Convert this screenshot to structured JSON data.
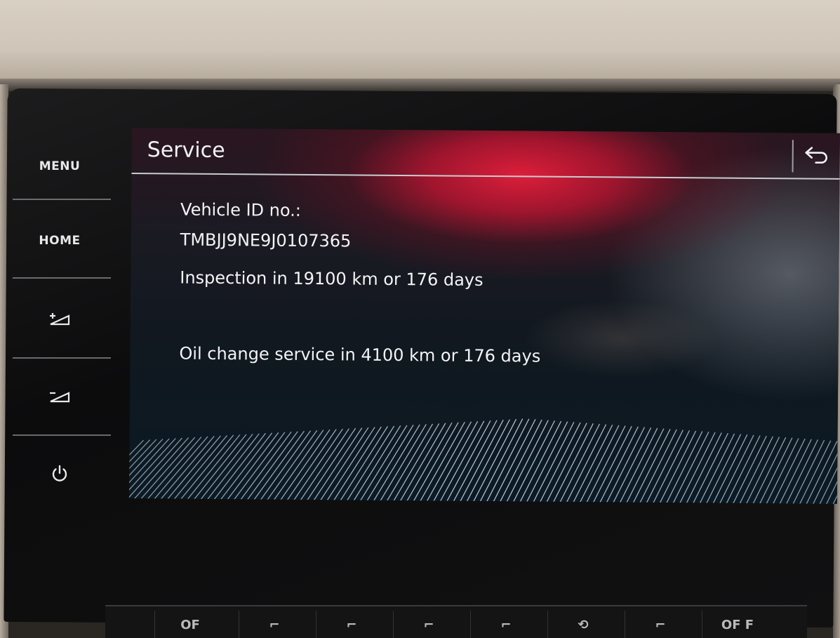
{
  "hard_keys": {
    "menu_label": "MENU",
    "home_label": "HOME",
    "volume_up_icon": "volume-up-icon",
    "volume_down_icon": "volume-down-icon",
    "power_icon": "power-icon"
  },
  "screen": {
    "title": "Service",
    "back_icon": "back-arrow-icon",
    "vehicle_id_label": "Vehicle ID no.:",
    "vehicle_id_value": "TMBJJ9NE9J0107365",
    "inspection": "Inspection in 19100 km or 176 days",
    "oil_change": "Oil change service in 4100 km or 176 days"
  },
  "climate_bar": {
    "off_left": "OF",
    "off_right": "OF F",
    "icons": [
      "seat-heat-icon",
      "seat-heat-icon",
      "seat-heat-icon",
      "seat-heat-icon",
      "recirculation-icon",
      "seat-vent-icon"
    ]
  },
  "colors": {
    "accent_red": "#e0193c",
    "text": "#f4f4f6",
    "screen_bg": "#0b1820"
  }
}
